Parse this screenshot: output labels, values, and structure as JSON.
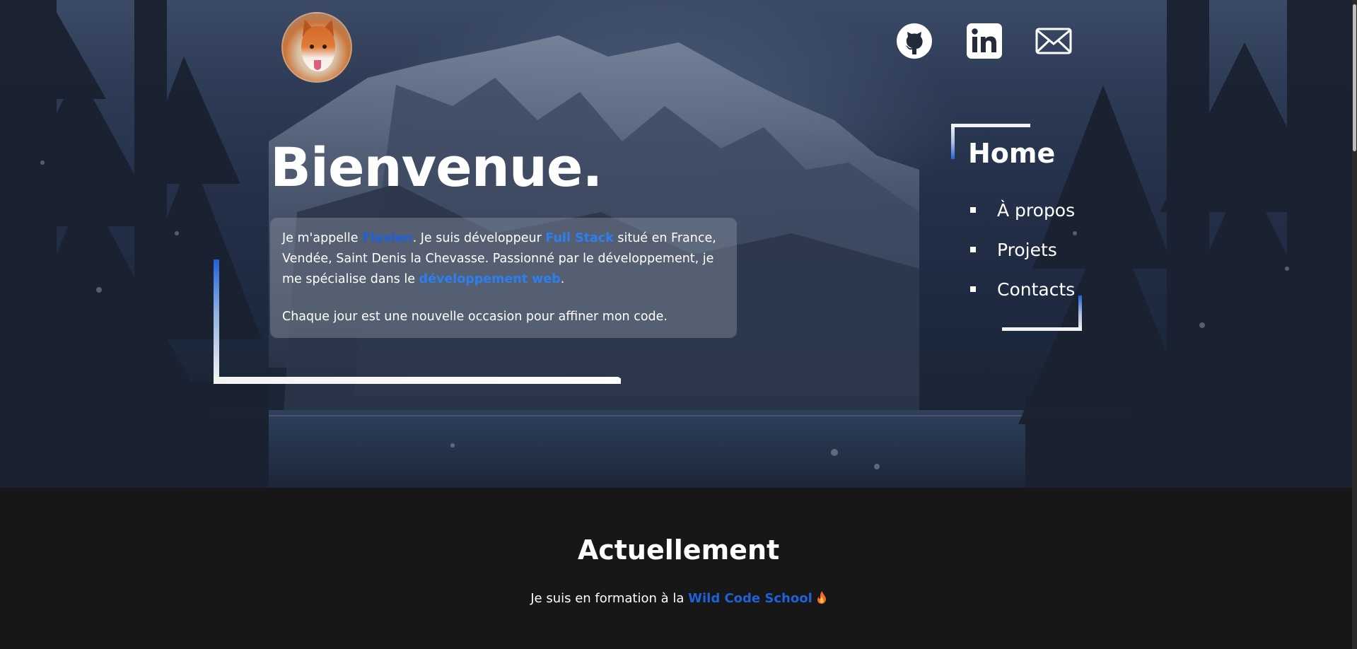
{
  "header": {
    "avatar_alt": "fox",
    "social": [
      "github-icon",
      "linkedin-icon",
      "mail-icon"
    ]
  },
  "hero": {
    "title": "Bienvenue.",
    "intro": {
      "p1_before_name": "Je m'appelle ",
      "name": "Flavien",
      "p1_after_name": ". Je suis développeur ",
      "role": "Full Stack",
      "p1_after_role": " situé en France, Vendée, Saint Denis la Chevasse. Passionné par le développement, je me spécialise dans le ",
      "specialty": "développement web",
      "p1_end": ".",
      "p2": "Chaque jour est une nouvelle occasion pour affiner mon code."
    }
  },
  "nav": {
    "home": "Home",
    "items": [
      "À propos",
      "Projets",
      "Contacts"
    ]
  },
  "current": {
    "title": "Actuellement",
    "text_before": "Je suis en formation à la ",
    "school": "Wild Code School"
  },
  "colors": {
    "accent": "#2d7ff0",
    "accent_dark": "#1f61d9",
    "dark_bg": "#171717"
  }
}
